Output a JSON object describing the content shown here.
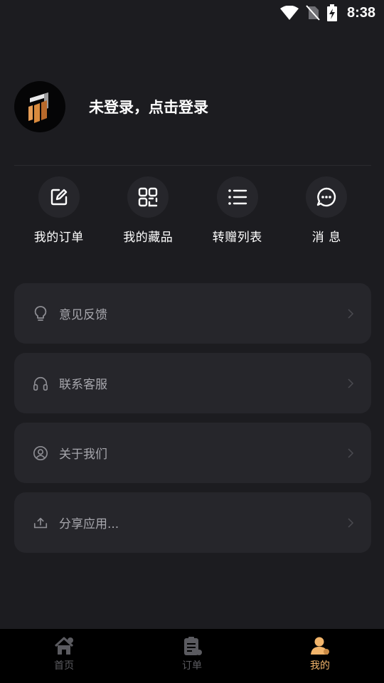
{
  "status_bar": {
    "time": "8:38",
    "icons": [
      "wifi-icon",
      "no-sim-icon",
      "battery-charging-icon"
    ]
  },
  "profile": {
    "login_prompt": "未登录，点击登录",
    "avatar_icon": "app-logo"
  },
  "quick_actions": [
    {
      "label": "我的订单",
      "icon": "edit-icon"
    },
    {
      "label": "我的藏品",
      "icon": "grid-icon"
    },
    {
      "label": "转赠列表",
      "icon": "list-icon"
    },
    {
      "label": "消 息",
      "icon": "chat-icon"
    }
  ],
  "menu": [
    {
      "label": "意见反馈",
      "icon": "lightbulb-icon"
    },
    {
      "label": "联系客服",
      "icon": "headphones-icon"
    },
    {
      "label": "关于我们",
      "icon": "user-circle-icon"
    },
    {
      "label": "分享应用...",
      "icon": "upload-icon"
    }
  ],
  "tab_bar": {
    "tabs": [
      {
        "label": "首页",
        "icon": "home-icon",
        "active": false
      },
      {
        "label": "订单",
        "icon": "clipboard-icon",
        "active": false
      },
      {
        "label": "我的",
        "icon": "person-icon",
        "active": true
      }
    ]
  },
  "colors": {
    "background": "#1c1c20",
    "card": "#26262b",
    "accent": "#f2b56b",
    "tab_inactive": "#5b5b60",
    "menu_text": "#a7a7ad"
  }
}
